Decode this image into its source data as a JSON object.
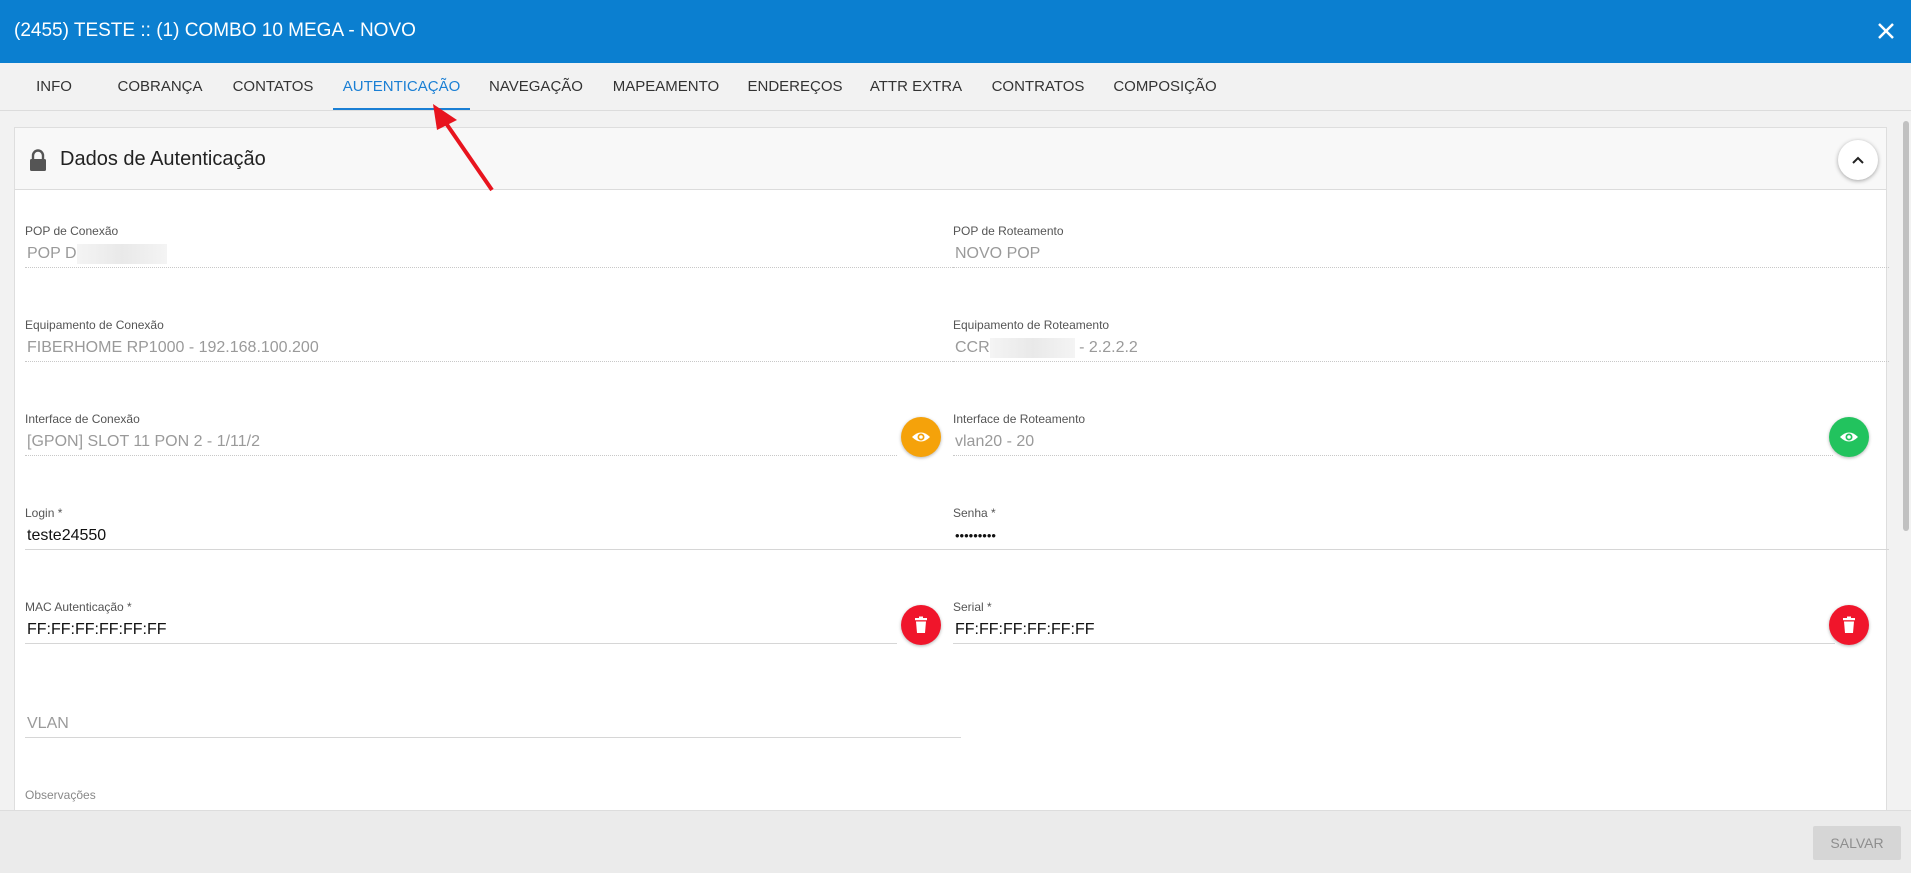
{
  "window": {
    "title": "(2455) TESTE :: (1) COMBO 10 MEGA - NOVO",
    "close_icon": "close-icon"
  },
  "tabs": [
    {
      "label": "INFO",
      "active": false
    },
    {
      "label": "COBRANÇA",
      "active": false
    },
    {
      "label": "CONTATOS",
      "active": false
    },
    {
      "label": "AUTENTICAÇÃO",
      "active": true
    },
    {
      "label": "NAVEGAÇÃO",
      "active": false
    },
    {
      "label": "MAPEAMENTO",
      "active": false
    },
    {
      "label": "ENDEREÇOS",
      "active": false
    },
    {
      "label": "ATTR EXTRA",
      "active": false
    },
    {
      "label": "CONTRATOS",
      "active": false
    },
    {
      "label": "COMPOSIÇÃO",
      "active": false
    }
  ],
  "section": {
    "title": "Dados de Autenticação",
    "icon": "lock-icon",
    "collapse_icon": "chevron-up-icon"
  },
  "fields": {
    "pop_conexao": {
      "label": "POP de Conexão",
      "value": "POP D"
    },
    "pop_roteamento": {
      "label": "POP de Roteamento",
      "value": "NOVO POP"
    },
    "equip_conexao": {
      "label": "Equipamento de Conexão",
      "value": "FIBERHOME RP1000 - 192.168.100.200"
    },
    "equip_roteamento": {
      "label": "Equipamento de Roteamento",
      "value_start": "CCR",
      "value_end": "- 2.2.2.2"
    },
    "iface_conexao": {
      "label": "Interface de Conexão",
      "value": "[GPON] SLOT 11 PON 2 - 1/11/2"
    },
    "iface_roteamento": {
      "label": "Interface de Roteamento",
      "value": "vlan20 - 20"
    },
    "login": {
      "label": "Login *",
      "value": "teste24550"
    },
    "senha": {
      "label": "Senha *",
      "value": "•••••••••"
    },
    "mac": {
      "label": "MAC Autenticação *",
      "value": "FF:FF:FF:FF:FF:FF"
    },
    "serial": {
      "label": "Serial *",
      "value": "FF:FF:FF:FF:FF:FF"
    },
    "vlan": {
      "placeholder": "VLAN"
    },
    "observacoes": {
      "label": "Observações"
    }
  },
  "buttons": {
    "save_label": "SALVAR"
  },
  "colors": {
    "header": "#0b7fd0",
    "active_tab": "#1a7fd4",
    "view_orange": "#f5a20a",
    "view_green": "#22c35e",
    "delete_red": "#f0152b",
    "annotation_arrow": "#e8141e"
  }
}
